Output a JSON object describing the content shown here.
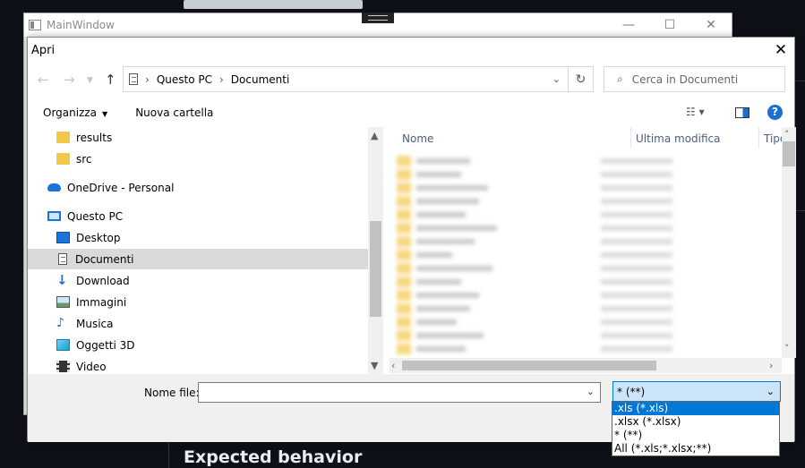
{
  "main_window": {
    "title": "MainWindow",
    "controls": [
      "—",
      "☐",
      "✕"
    ]
  },
  "background": {
    "bottom_text": "Expected behavior"
  },
  "dialog": {
    "title": "Apri",
    "close": "✕",
    "breadcrumb": [
      "Questo PC",
      "Documenti"
    ],
    "search_placeholder": "Cerca in Documenti",
    "toolbar": {
      "organize": "Organizza",
      "new_folder": "Nuova cartella"
    },
    "nav_items": [
      {
        "label": "results",
        "icon": "folder-icon"
      },
      {
        "label": "src",
        "icon": "folder-icon"
      },
      {
        "label": "OneDrive - Personal",
        "icon": "cloud-icon"
      },
      {
        "label": "Questo PC",
        "icon": "computer-icon"
      },
      {
        "label": "Desktop",
        "icon": "desktop-icon"
      },
      {
        "label": "Documenti",
        "icon": "document-icon"
      },
      {
        "label": "Download",
        "icon": "download-icon"
      },
      {
        "label": "Immagini",
        "icon": "pictures-icon"
      },
      {
        "label": "Musica",
        "icon": "music-icon"
      },
      {
        "label": "Oggetti 3D",
        "icon": "3d-objects-icon"
      },
      {
        "label": "Video",
        "icon": "video-icon"
      }
    ],
    "columns": [
      "Nome",
      "Ultima modifica",
      "Tipo"
    ],
    "file_name_label": "Nome file:",
    "file_name_value": "",
    "file_type_selected": "* (**)",
    "file_type_options": [
      ".xls (*.xls)",
      ".xlsx (*.xlsx)",
      "* (**)",
      "All (*.xls;*.xlsx;**)"
    ]
  },
  "colors": {
    "accent": "#0078d7",
    "folder": "#f3c849",
    "selected": "#d9d9d9"
  }
}
